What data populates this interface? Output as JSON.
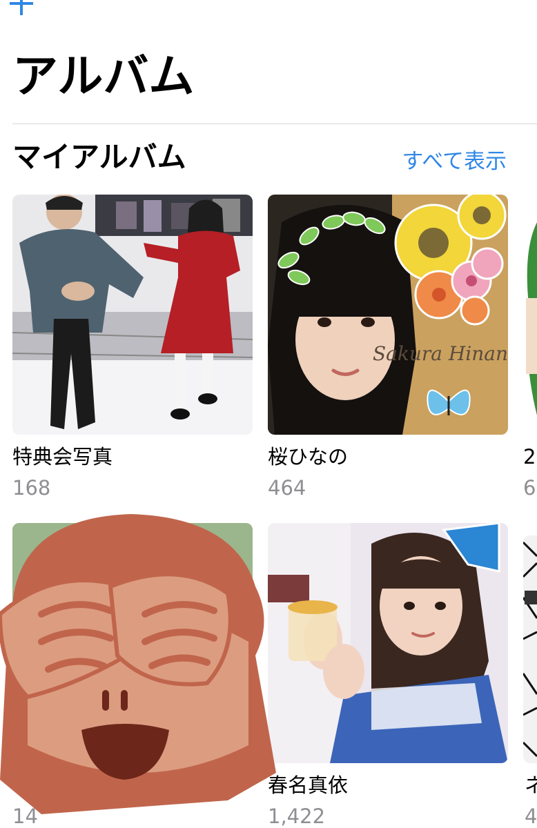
{
  "header": {
    "add_icon": "plus-icon",
    "title": "アルバム"
  },
  "section": {
    "title": "マイアルバム",
    "see_all_label": "すべて表示"
  },
  "albums": [
    {
      "name": "特典会写真",
      "count": "168"
    },
    {
      "name": "桜ひなの",
      "count": "464",
      "watermark": "Sakura Hinano"
    },
    {
      "name": "2",
      "count": "6"
    },
    {
      "name": "",
      "count": "14"
    },
    {
      "name": "春名真依",
      "count": "1,422"
    },
    {
      "name": "ネ",
      "count": "4"
    }
  ],
  "overlay": {
    "icon": "see-no-evil-monkey-icon"
  },
  "colors": {
    "accent": "#2f87e6",
    "secondary_text": "#8e8e93",
    "divider": "#d6d6d6"
  }
}
